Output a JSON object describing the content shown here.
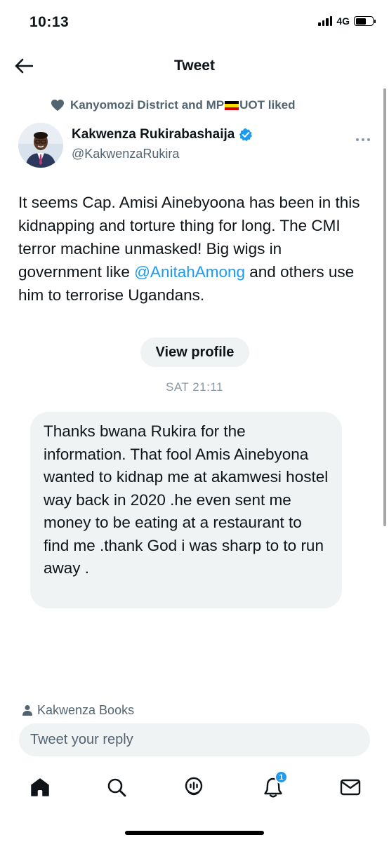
{
  "status_bar": {
    "time": "10:13",
    "network": "4G"
  },
  "nav": {
    "title": "Tweet"
  },
  "social_context": {
    "text_before_flag": "Kanyomozi District and MP",
    "text_after_flag": "UOT liked",
    "flag_colors": [
      "#000000",
      "#fcdc04",
      "#d90000"
    ]
  },
  "author": {
    "name": "Kakwenza Rukirabashaija",
    "handle": "@KakwenzaRukira",
    "verified_color": "#1d9bf0"
  },
  "tweet": {
    "text_part1": "It seems Cap. Amisi Ainebyoona has been in this kidnapping and torture thing for long. The CMI terror machine unmasked! Big wigs in government like ",
    "mention": "@AnitahAmong",
    "text_part2": " and others use him to terrorise Ugandans."
  },
  "view_profile_label": "View profile",
  "timestamp": "SAT 21:11",
  "message": {
    "text": "Thanks bwana Rukira for the information. That fool Amis Ainebyona wanted to kidnap me at akamwesi hostel way back in 2020 .he even sent me money to be eating at a restaurant to find me .thank God i was sharp to to run away ."
  },
  "footer_author": {
    "text": "Kakwenza Books"
  },
  "reply": {
    "placeholder": "Tweet your reply"
  },
  "tab_bar": {
    "items": [
      {
        "icon": "home-icon"
      },
      {
        "icon": "search-icon"
      },
      {
        "icon": "spaces-icon"
      },
      {
        "icon": "notifications-icon",
        "badge": "1"
      },
      {
        "icon": "messages-icon"
      }
    ]
  },
  "colors": {
    "accent": "#1d9bf0",
    "secondary_text": "#536471",
    "bubble": "#eff3f4"
  }
}
